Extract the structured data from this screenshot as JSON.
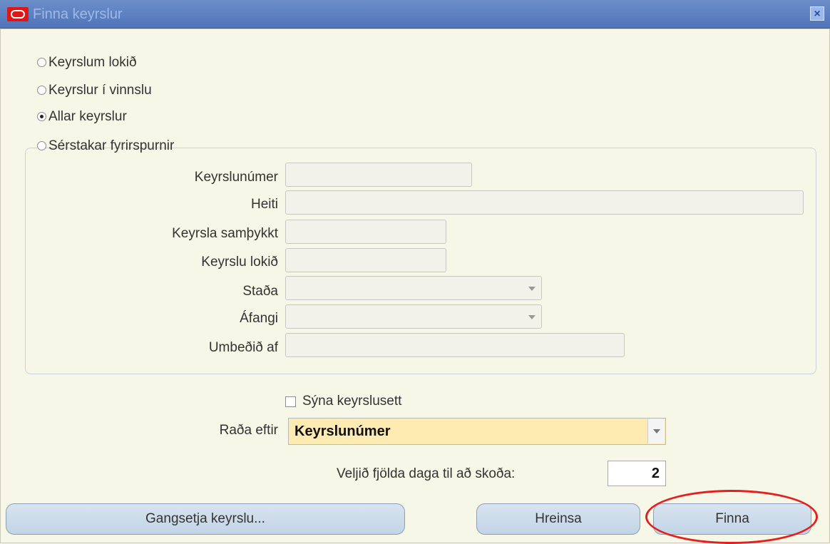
{
  "window": {
    "title": "Finna keyrslur",
    "close_symbol": "×"
  },
  "filters": {
    "completed": "Keyrslum lokið",
    "in_progress": "Keyrslur í vinnslu",
    "all": "Allar keyrslur",
    "specific": "Sérstakar fyrirspurnir",
    "selected": "all"
  },
  "fields": {
    "request_id_label": "Keyrslunúmer",
    "name_label": "Heiti",
    "submitted_label": "Keyrsla samþykkt",
    "completed_label": "Keyrslu lokið",
    "status_label": "Staða",
    "phase_label": "Áfangi",
    "requestor_label": "Umbeðið af"
  },
  "options": {
    "show_sets_label": "Sýna keyrslusett",
    "sort_label": "Raða eftir",
    "sort_value": "Keyrslunúmer",
    "days_label": "Veljið fjölda daga til að skoða:",
    "days_value": "2"
  },
  "buttons": {
    "submit": "Gangsetja keyrslu...",
    "clear": "Hreinsa",
    "find": "Finna"
  },
  "icons": {
    "app_logo": "oracle-logo-icon",
    "close": "close-icon",
    "dropdown": "chevron-down-icon"
  },
  "colors": {
    "background": "#f7f7e7",
    "titlebar": "#5a7fbf",
    "sort_field": "#fdebb2",
    "highlight": "#e31f1f"
  }
}
